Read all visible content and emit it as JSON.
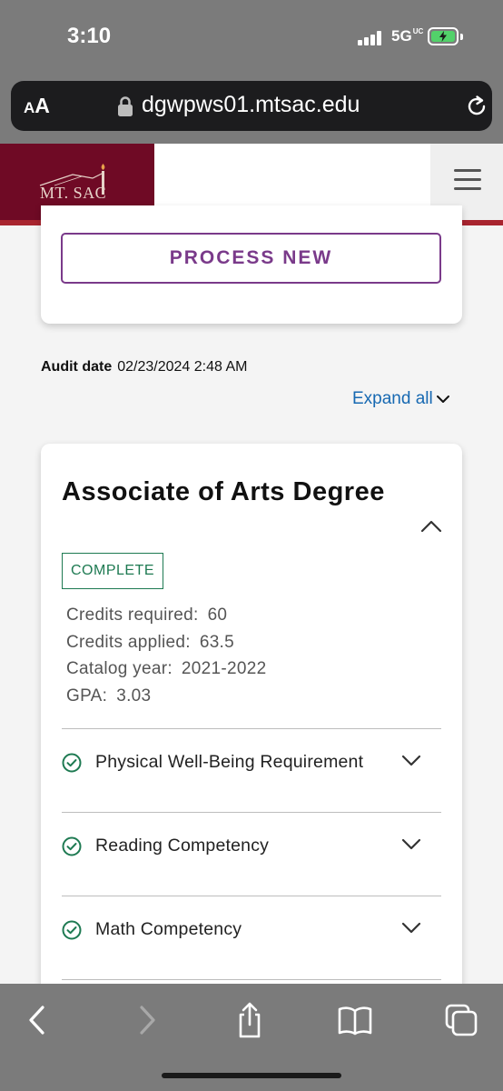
{
  "status_bar": {
    "time": "3:10",
    "network": "5G",
    "network_sub": "UC",
    "battery_color": "#52d16a"
  },
  "browser": {
    "font_size_small": "A",
    "font_size_big": "A",
    "url": "dgwpws01.mtsac.edu"
  },
  "site": {
    "brand": "MT. SAC",
    "brand_color": "#6f0a25",
    "accent_rule_color": "#a8242f"
  },
  "actions": {
    "process_new": "PROCESS NEW"
  },
  "audit": {
    "label": "Audit date",
    "value": "02/23/2024  2:48  AM"
  },
  "expand_all": "Expand all",
  "degree": {
    "title": "Associate of Arts Degree",
    "status": "COMPLETE",
    "details": [
      {
        "label": "Credits  required:",
        "value": "60"
      },
      {
        "label": "Credits  applied:",
        "value": "63.5"
      },
      {
        "label": "Catalog  year:",
        "value": "2021-2022"
      },
      {
        "label": "GPA:",
        "value": "3.03"
      }
    ],
    "requirements": [
      {
        "label": "Physical  Well-Being  Requirement",
        "status": "complete"
      },
      {
        "label": "Reading  Competency",
        "status": "complete"
      },
      {
        "label": "Math  Competency",
        "status": "complete"
      }
    ]
  },
  "toolbar": {
    "icons": [
      "back-icon",
      "forward-icon",
      "share-icon",
      "bookmarks-icon",
      "tabs-icon"
    ]
  }
}
